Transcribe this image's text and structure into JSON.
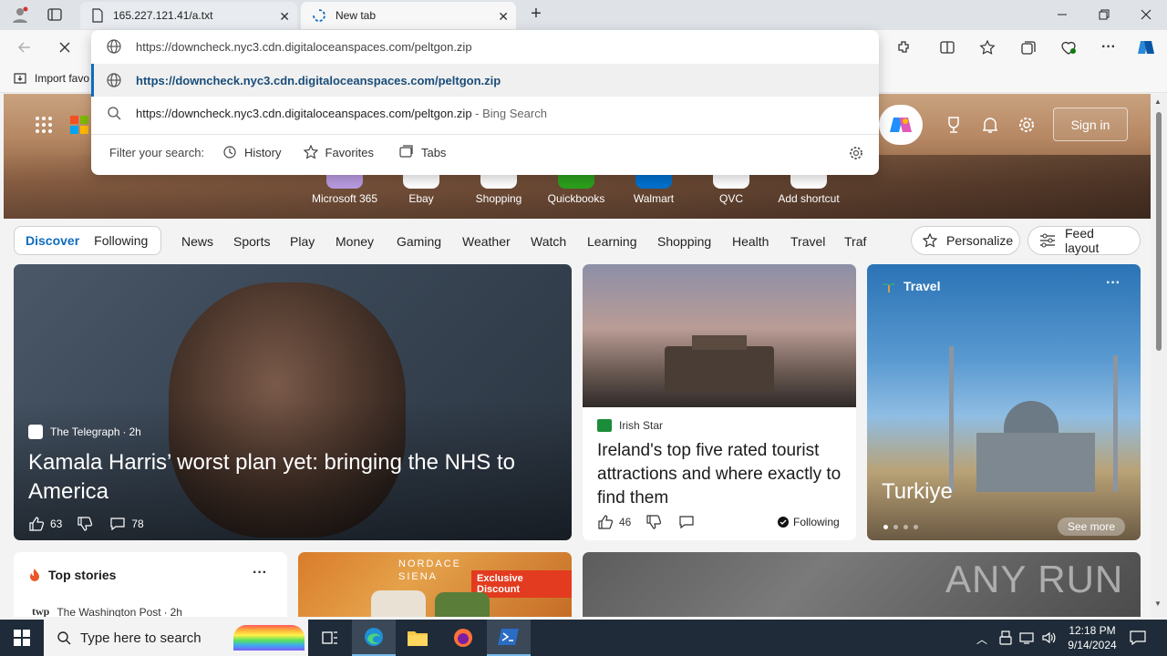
{
  "browser": {
    "tabs": [
      {
        "title": "165.227.121.41/a.txt"
      },
      {
        "title": "New tab"
      }
    ],
    "favorites_bar": {
      "import_label": "Import favo"
    }
  },
  "omnibox": {
    "input_value": "https://downcheck.nyc3.cdn.digitaloceanspaces.com/peltgon.zip",
    "suggestions": [
      {
        "text": "https://downcheck.nyc3.cdn.digitaloceanspaces.com/peltgon.zip",
        "suffix": ""
      },
      {
        "text": "https://downcheck.nyc3.cdn.digitaloceanspaces.com/peltgon.zip",
        "suffix": " - Bing Search"
      }
    ],
    "filter_label": "Filter your search:",
    "filters": [
      "History",
      "Favorites",
      "Tabs"
    ]
  },
  "header": {
    "sign_in": "Sign in"
  },
  "shortcuts": [
    "Microsoft 365",
    "Ebay",
    "Shopping",
    "Quickbooks",
    "Walmart",
    "QVC",
    "Add shortcut"
  ],
  "nav": {
    "discover": "Discover",
    "following": "Following",
    "items": [
      "News",
      "Sports",
      "Play",
      "Money",
      "Gaming",
      "Weather",
      "Watch",
      "Learning",
      "Shopping",
      "Health",
      "Travel",
      "Traf"
    ],
    "personalize": "Personalize",
    "feed_layout": "Feed layout"
  },
  "cards": {
    "main": {
      "source": "The Telegraph",
      "age": "2h",
      "headline": "Kamala Harris’ worst plan yet: bringing the NHS to America",
      "likes": "63",
      "comments": "78"
    },
    "ireland": {
      "source": "Irish Star",
      "headline": "Ireland's top five rated tourist attractions and where exactly to find them",
      "likes": "46",
      "following": "Following"
    },
    "travel": {
      "category": "Travel",
      "title": "Turkiye",
      "see_more": "See more"
    },
    "top_stories": {
      "title": "Top stories",
      "source": "The Washington Post",
      "age": "2h"
    },
    "ad": {
      "brand": "NORDACE SIENA",
      "badge": "Exclusive Discount"
    },
    "watermark": "ANY RUN"
  },
  "taskbar": {
    "search_placeholder": "Type here to search",
    "time": "12:18 PM",
    "date": "9/14/2024"
  }
}
